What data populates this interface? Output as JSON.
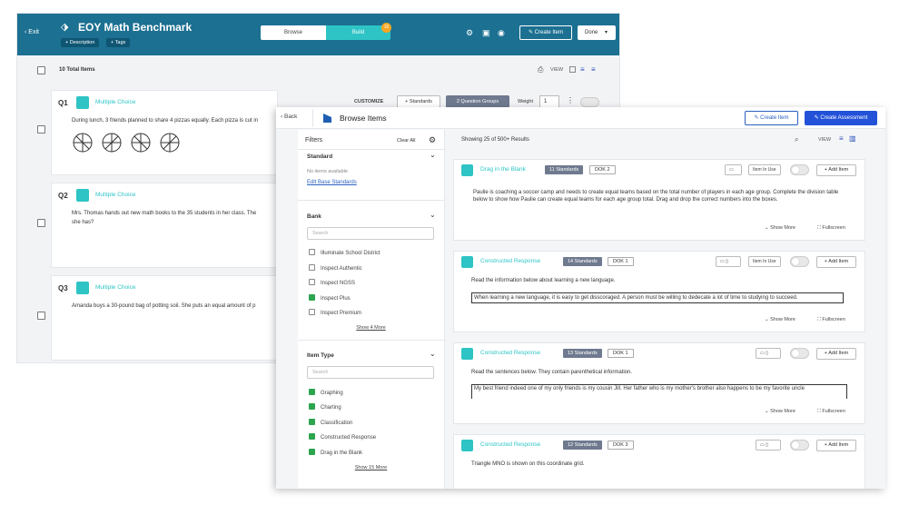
{
  "back_app": {
    "exit_label": "Exit",
    "title": "EOY Math Benchmark",
    "description_label": "+ Description",
    "tags_label": "+ Tags",
    "tabs": [
      "Browse",
      "Build"
    ],
    "build_count": "10",
    "create_item_label": "Create Item",
    "done_label": "Done",
    "total_items": "10 Total Items",
    "view_label": "VIEW",
    "customize_label": "CUSTOMIZE",
    "standards_label": "+ Standards",
    "question_groups_label": "2 Question Groups",
    "weight_label": "Weight",
    "weight_value": "1",
    "questions": [
      {
        "num": "Q1",
        "type": "Multiple Choice",
        "text": "During lunch, 3 friends planned to share 4 pizzas equally. Each pizza is cut in"
      },
      {
        "num": "Q2",
        "type": "Multiple Choice",
        "text": "Mrs. Thomas hands out new math books to the 35 students in her class. The",
        "text2": "she has?"
      },
      {
        "num": "Q3",
        "type": "Multiple Choice",
        "text": "Amanda buys a 30-pound bag of potting soil. She puts an equal amount of p"
      }
    ]
  },
  "browse": {
    "back_label": "Back",
    "title": "Browse Items",
    "create_item_label": "Create Item",
    "create_assessment_label": "Create Assessment",
    "filters_label": "Filters",
    "clear_all_label": "Clear All",
    "showing": "Showing 25 of 500+ Results",
    "view_label": "VIEW",
    "standard_title": "Standard",
    "no_items": "No items available",
    "edit_base": "Edit Base Standards",
    "bank_title": "Bank",
    "search_placeholder": "Search",
    "bank_options": [
      {
        "label": "Illuminate School District",
        "checked": false
      },
      {
        "label": "Inspect Authentic",
        "checked": false
      },
      {
        "label": "Inspect NGSS",
        "checked": false
      },
      {
        "label": "Inspect Plus",
        "checked": true
      },
      {
        "label": "Inspect Premium",
        "checked": false
      }
    ],
    "bank_more": "Show 4 More",
    "item_type_title": "Item Type",
    "type_options": [
      {
        "label": "Graphing",
        "checked": true
      },
      {
        "label": "Charting",
        "checked": true
      },
      {
        "label": "Classification",
        "checked": true
      },
      {
        "label": "Constructed Response",
        "checked": true
      },
      {
        "label": "Drag in the Blank",
        "checked": true
      }
    ],
    "type_more": "Show 15 More",
    "items": [
      {
        "type": "Drag in the Blank",
        "standards": "11 Standards",
        "dok": "DOK 2",
        "in_use": "Item In Use",
        "add": "+ Add Item",
        "text": "Paulie is coaching a soccer camp and needs to create equal teams based on the total number of players in each age group. Complete the division table below to show how Paulie can create equal teams for each age group total. Drag and drop the correct numbers into the boxes.",
        "show_more": "Show More",
        "fullscreen": "Fullscreen"
      },
      {
        "type": "Constructed Response",
        "standards": "14 Standards",
        "dok": "DOK 1",
        "in_use": "Item In Use",
        "add": "+ Add Item",
        "text": "Read the information below about learning a new language.",
        "text2": "When learning a new language, it is easy to get disscoraged.  A person must be willing to dedecate a lot of time to studying to succeed.",
        "show_more": "Show More",
        "fullscreen": "Fullscreen"
      },
      {
        "type": "Constructed Response",
        "standards": "13 Standards",
        "dok": "DOK 1",
        "add": "+ Add Item",
        "text": "Read the sentences below.  They contain parenthetical information.",
        "text2": "My best friend indeed one of my only friends is my cousin Jill.  Her father who is my mother's brother also happens to be my favorite uncle",
        "show_more": "Show More",
        "fullscreen": "Fullscreen"
      },
      {
        "type": "Constructed Response",
        "standards": "12 Standards",
        "dok": "DOK 3",
        "add": "+ Add Item",
        "text": "Triangle MNO is shown on this coordinate grid."
      }
    ]
  }
}
